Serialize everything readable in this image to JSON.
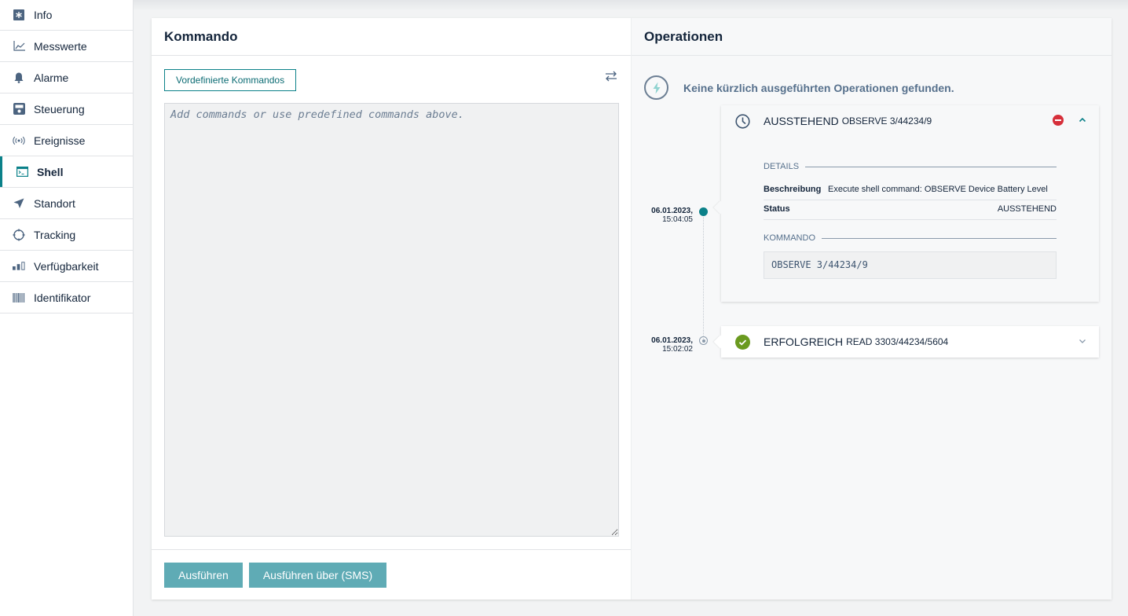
{
  "sidebar": {
    "items": [
      {
        "label": "Info",
        "icon": "info-asterisk-icon",
        "active": false
      },
      {
        "label": "Messwerte",
        "icon": "line-chart-icon",
        "active": false
      },
      {
        "label": "Alarme",
        "icon": "bell-icon",
        "active": false
      },
      {
        "label": "Steuerung",
        "icon": "control-panel-icon",
        "active": false
      },
      {
        "label": "Ereignisse",
        "icon": "broadcast-icon",
        "active": false
      },
      {
        "label": "Shell",
        "icon": "terminal-icon",
        "active": true
      },
      {
        "label": "Standort",
        "icon": "location-arrow-icon",
        "active": false
      },
      {
        "label": "Tracking",
        "icon": "crosshair-icon",
        "active": false
      },
      {
        "label": "Verfügbarkeit",
        "icon": "signal-bars-icon",
        "active": false
      },
      {
        "label": "Identifikator",
        "icon": "barcode-icon",
        "active": false
      }
    ]
  },
  "command": {
    "title": "Kommando",
    "predefined_label": "Vordefinierte Kommandos",
    "swap_icon": "swap-arrows-icon",
    "editor_value": "",
    "editor_placeholder": "Add commands or use predefined commands above.",
    "execute_label": "Ausführen",
    "execute_sms_label": "Ausführen über (SMS)"
  },
  "operations": {
    "title": "Operationen",
    "empty_message": "Keine kürzlich ausgeführten Operationen gefunden.",
    "items": [
      {
        "date": "06.01.2023,",
        "time": "15:04:05",
        "status": "AUSSTEHEND",
        "command": "OBSERVE 3/44234/9",
        "status_icon": "clock-icon",
        "expanded": true,
        "details_title": "DETAILS",
        "description_label": "Beschreibung",
        "description_value": "Execute shell command: OBSERVE Device Battery Level",
        "status_label": "Status",
        "status_value": "AUSSTEHEND",
        "command_title": "KOMMANDO",
        "command_value": "OBSERVE 3/44234/9"
      },
      {
        "date": "06.01.2023,",
        "time": "15:02:02",
        "status": "ERFOLGREICH",
        "command": "READ 3303/44234/5604",
        "status_icon": "check-circle-icon",
        "expanded": false
      }
    ]
  },
  "colors": {
    "accent": "#0b8189",
    "button_primary": "#5fabb5",
    "success": "#6a9a1f",
    "danger": "#d62f3a"
  }
}
